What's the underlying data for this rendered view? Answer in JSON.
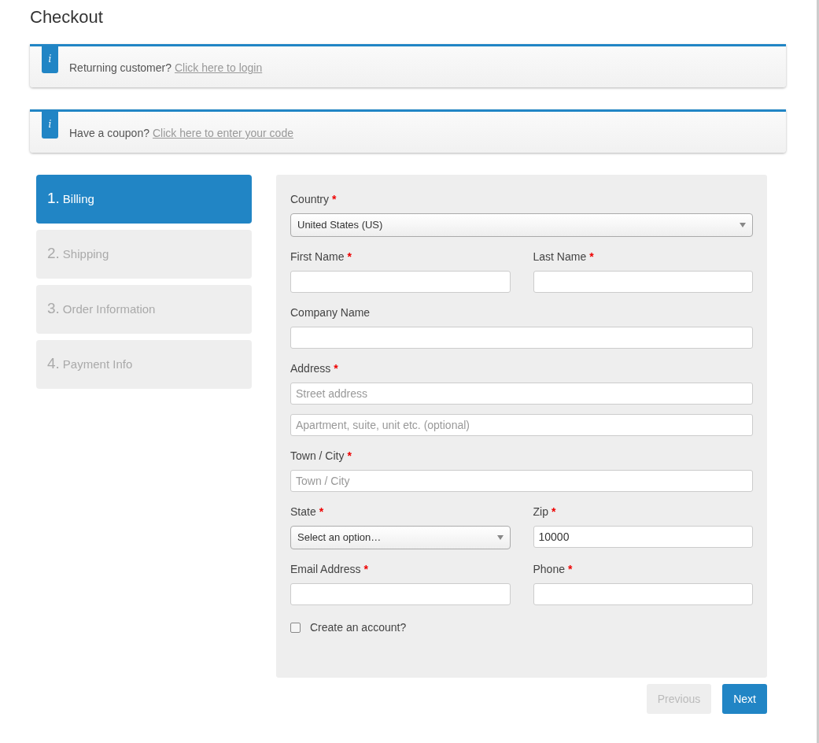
{
  "page_title": "Checkout",
  "notices": [
    {
      "text": "Returning customer?",
      "link": "Click here to login",
      "icon": "i"
    },
    {
      "text": "Have a coupon?",
      "link": "Click here to enter your code",
      "icon": "i"
    }
  ],
  "steps": [
    {
      "number": "1.",
      "label": "Billing",
      "selected": true
    },
    {
      "number": "2.",
      "label": "Shipping",
      "selected": false
    },
    {
      "number": "3.",
      "label": "Order Information",
      "selected": false
    },
    {
      "number": "4.",
      "label": "Payment Info",
      "selected": false
    }
  ],
  "form_rows": [
    [
      {
        "label": "Country",
        "required": true,
        "controls": [
          {
            "kind": "select",
            "value": "United States (US)"
          }
        ]
      }
    ],
    [
      {
        "label": "First Name",
        "required": true,
        "controls": [
          {
            "kind": "text"
          }
        ]
      },
      {
        "label": "Last Name",
        "required": true,
        "controls": [
          {
            "kind": "text"
          }
        ]
      }
    ],
    [
      {
        "label": "Company Name",
        "required": false,
        "controls": [
          {
            "kind": "text"
          }
        ]
      }
    ],
    [
      {
        "label": "Address",
        "required": true,
        "controls": [
          {
            "kind": "text",
            "placeholder": "Street address"
          },
          {
            "kind": "text",
            "placeholder": "Apartment, suite, unit etc. (optional)"
          }
        ]
      }
    ],
    [
      {
        "label": "Town / City",
        "required": true,
        "controls": [
          {
            "kind": "text",
            "placeholder": "Town / City"
          }
        ]
      }
    ],
    [
      {
        "label": "State",
        "required": true,
        "controls": [
          {
            "kind": "select",
            "value": "Select an option…"
          }
        ]
      },
      {
        "label": "Zip",
        "required": true,
        "controls": [
          {
            "kind": "text",
            "value": "10000"
          }
        ]
      }
    ],
    [
      {
        "label": "Email Address",
        "required": true,
        "controls": [
          {
            "kind": "text"
          }
        ]
      },
      {
        "label": "Phone",
        "required": true,
        "controls": [
          {
            "kind": "text"
          }
        ]
      }
    ]
  ],
  "required_mark": "*",
  "create_account": {
    "label": "Create an account?",
    "checked": false
  },
  "buttons": [
    {
      "label": "Previous",
      "disabled": true
    },
    {
      "label": "Next",
      "disabled": false
    }
  ]
}
